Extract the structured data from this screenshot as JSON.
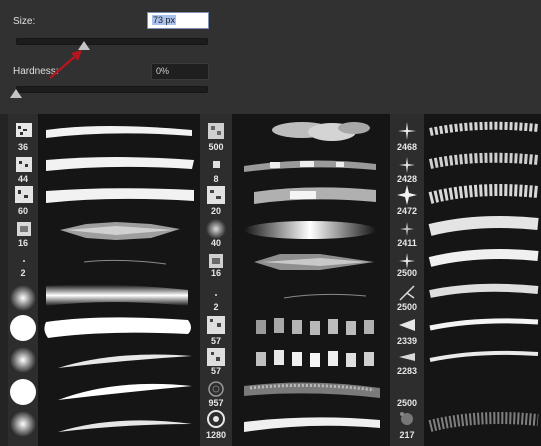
{
  "size": {
    "label": "Size:",
    "value": "73 px"
  },
  "hardness": {
    "label": "Hardness:",
    "value": "0%"
  },
  "annotation": {
    "arrow_color": "#b5151f"
  },
  "brush_columns": [
    {
      "numbers": [
        "36",
        "44",
        "60",
        "16",
        "2",
        "",
        "",
        "",
        "",
        ""
      ]
    },
    {
      "numbers": [
        "500",
        "8",
        "20",
        "40",
        "16",
        "2",
        "57",
        "57",
        "957",
        "1280"
      ]
    },
    {
      "numbers": [
        "2468",
        "2428",
        "2472",
        "2411",
        "2500",
        "2500",
        "2339",
        "2283",
        "2500",
        "217"
      ]
    }
  ]
}
